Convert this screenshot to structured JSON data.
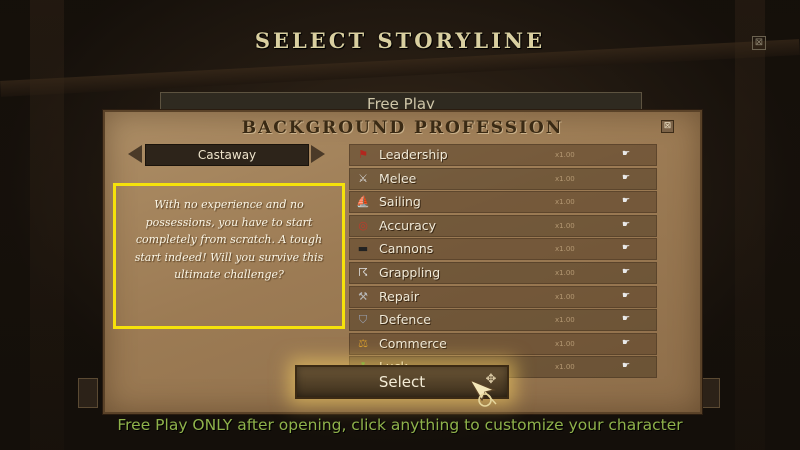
{
  "screen_title": "SELECT STORYLINE",
  "close_glyph": "⊠",
  "mode_tab": "Free Play",
  "panel": {
    "title": "BACKGROUND PROFESSION",
    "close_glyph": "⊠",
    "profession": "Castaway",
    "description": "With no experience and no possessions, you have to start completely from scratch. A tough start indeed! Will you survive this ultimate challenge?",
    "skills": [
      {
        "label": "Leadership",
        "multiplier": "x1.00",
        "icon": "flag-icon",
        "glyph": "⚑",
        "color": "#b3261e"
      },
      {
        "label": "Melee",
        "multiplier": "x1.00",
        "icon": "crossed-swords-icon",
        "glyph": "⚔",
        "color": "#d8d8d8"
      },
      {
        "label": "Sailing",
        "multiplier": "x1.00",
        "icon": "sail-icon",
        "glyph": "⛵",
        "color": "#e8e2cc"
      },
      {
        "label": "Accuracy",
        "multiplier": "x1.00",
        "icon": "target-icon",
        "glyph": "◎",
        "color": "#c0392b"
      },
      {
        "label": "Cannons",
        "multiplier": "x1.00",
        "icon": "cannon-icon",
        "glyph": "▬",
        "color": "#222222"
      },
      {
        "label": "Grappling",
        "multiplier": "x1.00",
        "icon": "grappling-hook-icon",
        "glyph": "☈",
        "color": "#e0e0e0"
      },
      {
        "label": "Repair",
        "multiplier": "x1.00",
        "icon": "hammer-icon",
        "glyph": "⚒",
        "color": "#b7b7b7"
      },
      {
        "label": "Defence",
        "multiplier": "x1.00",
        "icon": "shield-icon",
        "glyph": "⛉",
        "color": "#9aa4b8"
      },
      {
        "label": "Commerce",
        "multiplier": "x1.00",
        "icon": "coins-icon",
        "glyph": "⚖",
        "color": "#d39a2c"
      },
      {
        "label": "Luck",
        "multiplier": "x1.00",
        "icon": "clover-icon",
        "glyph": "☘",
        "color": "#4e9a2e"
      }
    ],
    "select_label": "Select"
  },
  "bottom_hint": "Free Play ONLY after opening, click anything to customize your character"
}
